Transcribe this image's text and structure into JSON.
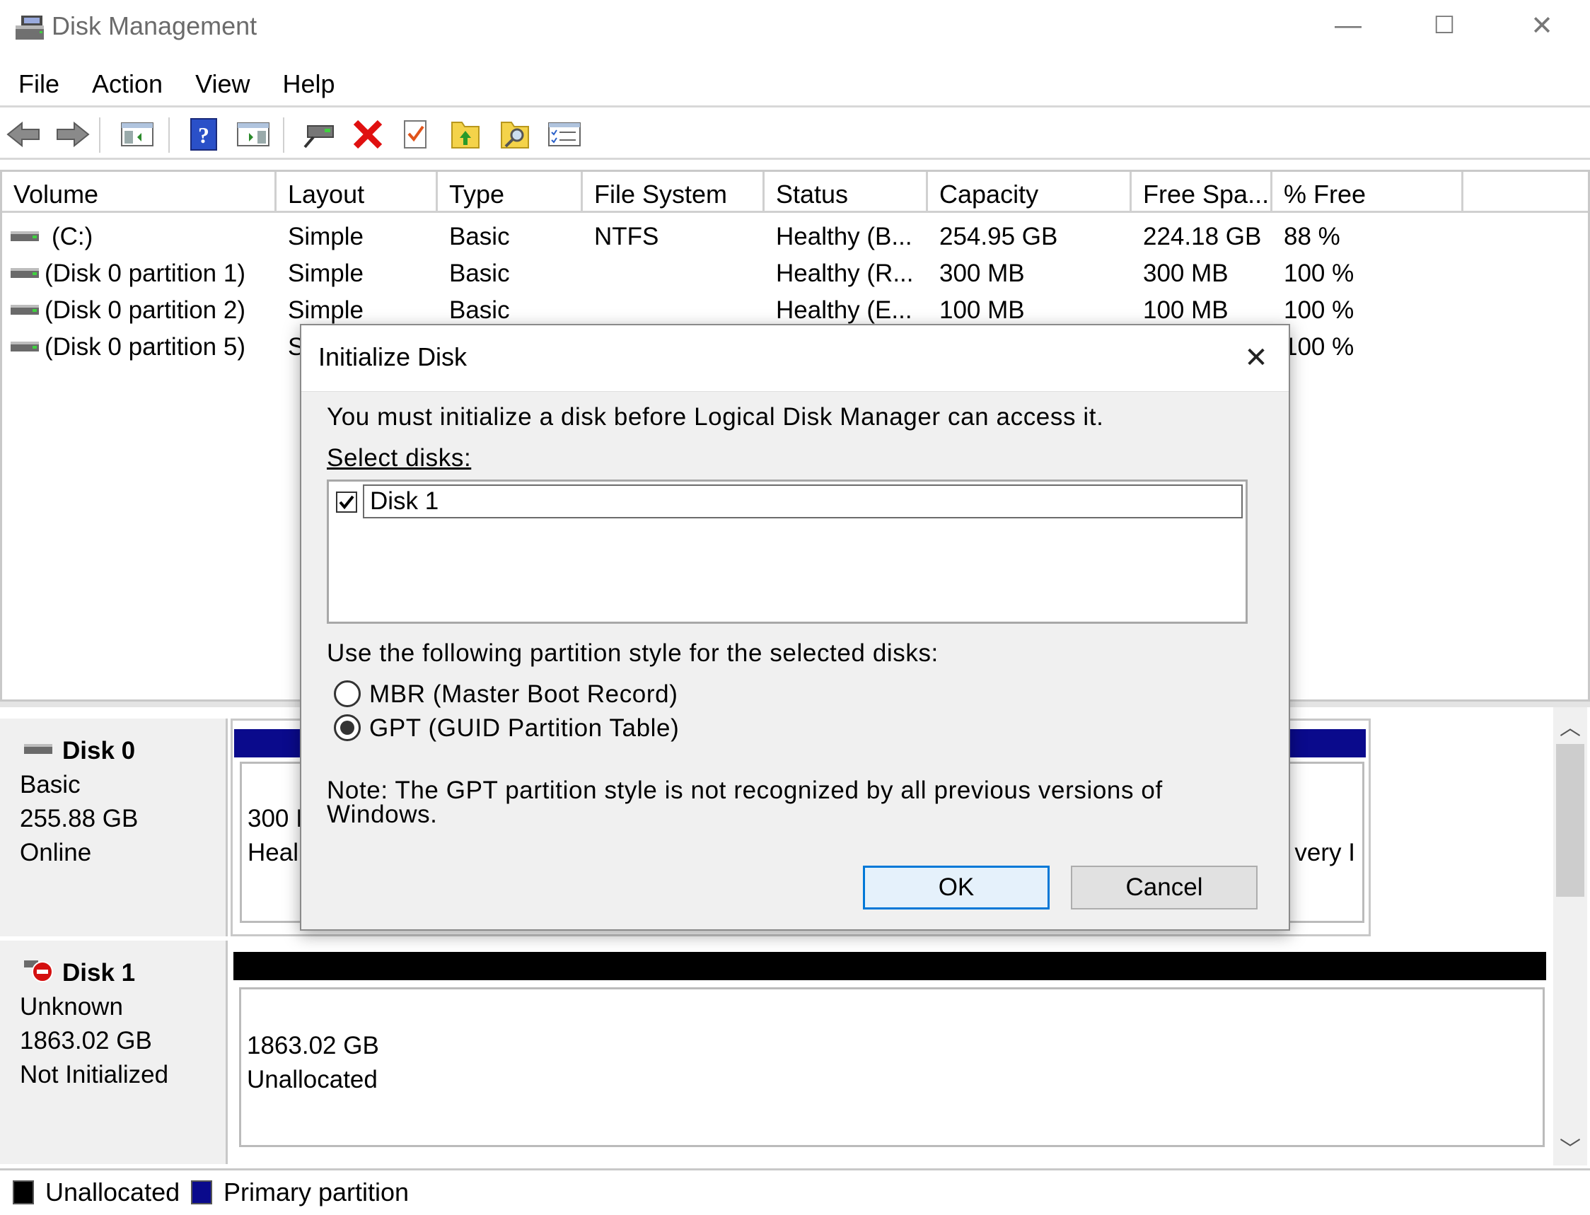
{
  "window": {
    "title": "Disk Management",
    "minimize": "—",
    "maximize": "☐",
    "close": "✕"
  },
  "menu": [
    "File",
    "Action",
    "View",
    "Help"
  ],
  "toolbar": [
    "back-icon",
    "forward-icon",
    "show-hide-console-tree-icon",
    "help-icon",
    "show-hide-action-pane-icon",
    "connect-drive-icon",
    "delete-icon",
    "properties-icon",
    "folder-up-icon",
    "explore-icon",
    "view-list-icon"
  ],
  "columns": [
    "Volume",
    "Layout",
    "Type",
    "File System",
    "Status",
    "Capacity",
    "Free Spa...",
    "% Free"
  ],
  "volumes": [
    {
      "volume": "(C:)",
      "layout": "Simple",
      "type": "Basic",
      "fs": "NTFS",
      "status": "Healthy (B...",
      "capacity": "254.95 GB",
      "free": "224.18 GB",
      "pct": "88 %"
    },
    {
      "volume": "(Disk 0 partition 1)",
      "layout": "Simple",
      "type": "Basic",
      "fs": "",
      "status": "Healthy (R...",
      "capacity": "300 MB",
      "free": "300 MB",
      "pct": "100 %"
    },
    {
      "volume": "(Disk 0 partition 2)",
      "layout": "Simple",
      "type": "Basic",
      "fs": "",
      "status": "Healthy (E...",
      "capacity": "100 MB",
      "free": "100 MB",
      "pct": "100 %"
    },
    {
      "volume": "(Disk 0 partition 5)",
      "layout": "S",
      "type": "",
      "fs": "",
      "status": "",
      "capacity": "",
      "free": "",
      "pct": "100 %"
    }
  ],
  "disks": [
    {
      "name": "Disk 0",
      "kind": "Basic",
      "size": "255.88 GB",
      "state": "Online",
      "partition_left": {
        "line1": "300 I",
        "line2": "Heal"
      },
      "partition_right": {
        "line2": "very I"
      }
    },
    {
      "name": "Disk 1",
      "kind": "Unknown",
      "size": "1863.02 GB",
      "state": "Not Initialized",
      "partition": {
        "line1": "1863.02 GB",
        "line2": "Unallocated"
      }
    }
  ],
  "legend": [
    {
      "label": "Unallocated",
      "color": "#000000"
    },
    {
      "label": "Primary partition",
      "color": "#0a0a8c"
    }
  ],
  "dialog": {
    "title": "Initialize Disk",
    "close": "✕",
    "intro": "You must initialize a disk before Logical Disk Manager can access it.",
    "select_label": "Select disks:",
    "disk_item": "Disk 1",
    "style_label": "Use the following partition style for the selected disks:",
    "mbr": "MBR (Master Boot Record)",
    "gpt": "GPT (GUID Partition Table)",
    "note_line1": "Note: The GPT partition style is not recognized by all previous versions of",
    "note_line2": "Windows.",
    "ok": "OK",
    "cancel": "Cancel"
  },
  "colors": {
    "primary_partition": "#0a0a8c",
    "unallocated": "#000000",
    "accent": "#0078d7"
  }
}
